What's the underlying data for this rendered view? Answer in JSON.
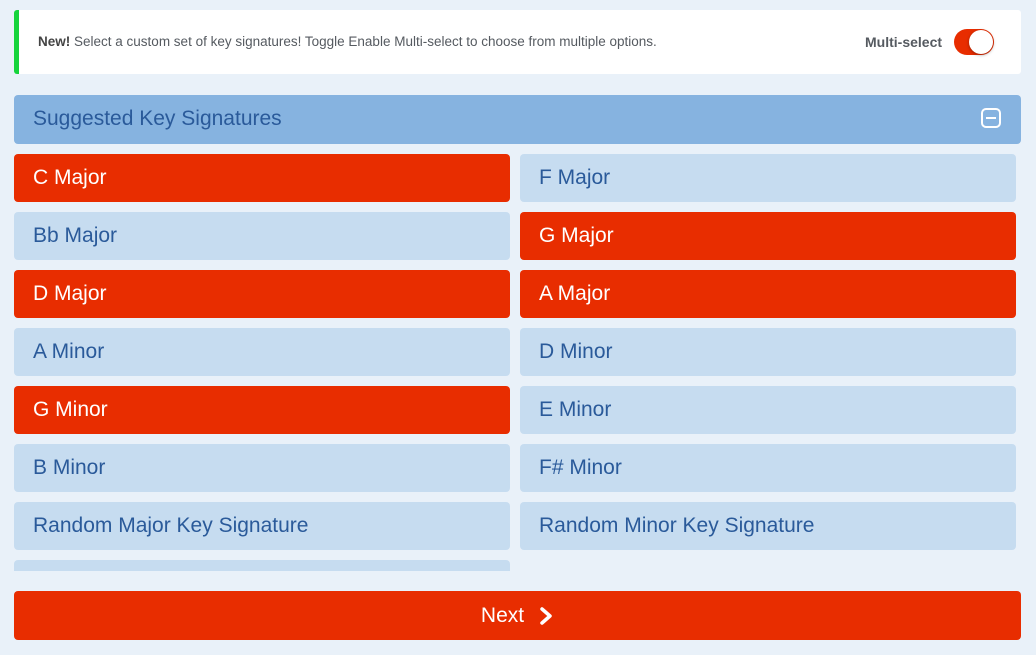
{
  "banner": {
    "badge": "New!",
    "message": " Select a custom set of key signatures! Toggle Enable Multi-select to choose from multiple options.",
    "toggle_label": "Multi-select",
    "toggle_on": true
  },
  "section": {
    "title": "Suggested Key Signatures",
    "collapse_icon": "minus-square-icon"
  },
  "options": [
    {
      "label": "C Major",
      "selected": true
    },
    {
      "label": "F Major",
      "selected": false
    },
    {
      "label": "Bb Major",
      "selected": false
    },
    {
      "label": "G Major",
      "selected": true
    },
    {
      "label": "D Major",
      "selected": true
    },
    {
      "label": "A Major",
      "selected": true
    },
    {
      "label": "A Minor",
      "selected": false
    },
    {
      "label": "D Minor",
      "selected": false
    },
    {
      "label": "G Minor",
      "selected": true
    },
    {
      "label": "E Minor",
      "selected": false
    },
    {
      "label": "B Minor",
      "selected": false
    },
    {
      "label": "F# Minor",
      "selected": false
    },
    {
      "label": "Random Major Key Signature",
      "selected": false
    },
    {
      "label": "Random Minor Key Signature",
      "selected": false
    }
  ],
  "footer": {
    "next_label": "Next",
    "next_icon": "chevron-right-icon"
  },
  "colors": {
    "accent": "#e82d00",
    "option_bg": "#c6dcf0",
    "header_bg": "#86b3e0",
    "banner_stripe": "#16d43c"
  }
}
